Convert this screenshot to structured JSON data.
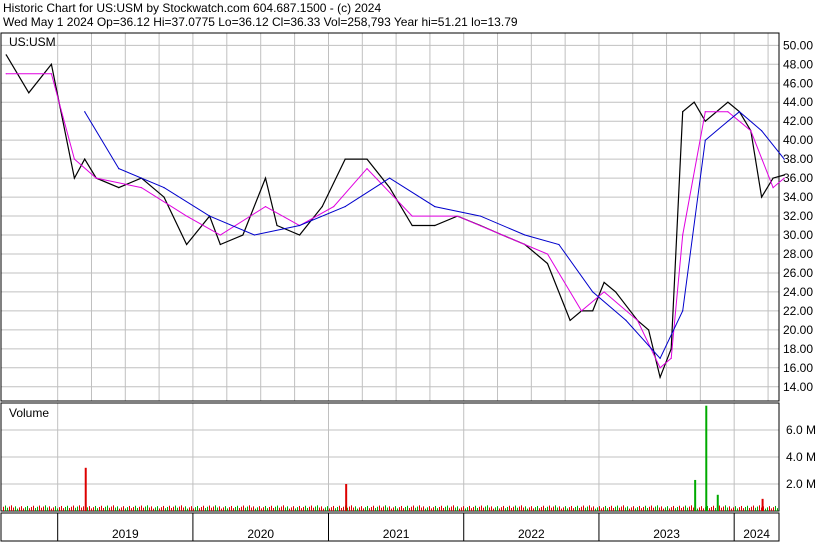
{
  "header": {
    "line1": "Historic Chart for US:USM by Stockwatch.com 604.687.1500 - (c) 2024",
    "line2": "Wed May  1 2024   Op=36.12   Hi=37.0775   Lo=36.12   Cl=36.33   Vol=258,793   Year hi=51.21   lo=13.79"
  },
  "colors": {
    "price": "#000000",
    "ma_short": "#e000e0",
    "ma_long": "#0000cc",
    "vol_up": "#00aa00",
    "vol_down": "#dd0000",
    "grid": "#c0c0c0"
  },
  "chart_data": [
    {
      "type": "line",
      "symbol_label": "US:USM",
      "ylim": [
        12.5,
        51.3
      ],
      "y_ticks": [
        "14.00",
        "16.00",
        "18.00",
        "20.00",
        "22.00",
        "24.00",
        "26.00",
        "28.00",
        "30.00",
        "32.00",
        "34.00",
        "36.00",
        "38.00",
        "40.00",
        "42.00",
        "44.00",
        "46.00",
        "48.00",
        "50.00"
      ],
      "x_ticks": [
        "2019",
        "2020",
        "2021",
        "2022",
        "2023",
        "2024"
      ],
      "x_range": [
        "2018-08-01",
        "2024-05-01"
      ],
      "grid": true,
      "series": [
        {
          "role": "price",
          "x": [
            "2018-08",
            "2018-10",
            "2018-12",
            "2019-02",
            "2019-03",
            "2019-04",
            "2019-06",
            "2019-08",
            "2019-10",
            "2019-12",
            "2020-02",
            "2020-03",
            "2020-05",
            "2020-07",
            "2020-08",
            "2020-10",
            "2020-12",
            "2021-02",
            "2021-04",
            "2021-06",
            "2021-08",
            "2021-10",
            "2021-12",
            "2022-02",
            "2022-04",
            "2022-06",
            "2022-08",
            "2022-10",
            "2022-11",
            "2022-12",
            "2023-01",
            "2023-02",
            "2023-04",
            "2023-05",
            "2023-06",
            "2023-07",
            "2023-08",
            "2023-09",
            "2023-10",
            "2023-12",
            "2024-01",
            "2024-02",
            "2024-03",
            "2024-04",
            "2024-05"
          ],
          "values": [
            49,
            45,
            48,
            36,
            38,
            36,
            35,
            36,
            34,
            29,
            32,
            29,
            30,
            36,
            31,
            30,
            33,
            38,
            38,
            35,
            31,
            31,
            32,
            31,
            30,
            29,
            27,
            21,
            22,
            22,
            25,
            24,
            21,
            20,
            15,
            18,
            43,
            44,
            42,
            44,
            43,
            41,
            34,
            36,
            36.33
          ]
        },
        {
          "role": "moving-average-short",
          "x": [
            "2018-08",
            "2018-12",
            "2019-02",
            "2019-04",
            "2019-08",
            "2019-12",
            "2020-03",
            "2020-07",
            "2020-10",
            "2021-01",
            "2021-04",
            "2021-08",
            "2021-12",
            "2022-04",
            "2022-08",
            "2022-11",
            "2023-01",
            "2023-04",
            "2023-06",
            "2023-07",
            "2023-08",
            "2023-10",
            "2023-12",
            "2024-02",
            "2024-04",
            "2024-05"
          ],
          "values": [
            47,
            47,
            38,
            36,
            35,
            32,
            30,
            33,
            31,
            33,
            37,
            32,
            32,
            30,
            28,
            22,
            24,
            21,
            16,
            17,
            30,
            43,
            43,
            41,
            35,
            36
          ]
        },
        {
          "role": "moving-average-long",
          "x": [
            "2019-03",
            "2019-06",
            "2019-10",
            "2020-02",
            "2020-06",
            "2020-10",
            "2021-02",
            "2021-06",
            "2021-10",
            "2022-02",
            "2022-06",
            "2022-09",
            "2022-12",
            "2023-03",
            "2023-06",
            "2023-08",
            "2023-10",
            "2023-12",
            "2024-01",
            "2024-03",
            "2024-05"
          ],
          "values": [
            43,
            37,
            35,
            32,
            30,
            31,
            33,
            36,
            33,
            32,
            30,
            29,
            24,
            21,
            17,
            22,
            40,
            42,
            43,
            41,
            38
          ]
        }
      ]
    },
    {
      "type": "bar",
      "title": "Volume",
      "ylim": [
        0,
        8.0
      ],
      "y_ticks": [
        "2.0 M",
        "4.0 M",
        "6.0 M"
      ],
      "unit": "M",
      "spikes": [
        {
          "x": "2019-03",
          "value": 3.2,
          "dir": "down"
        },
        {
          "x": "2021-02",
          "value": 2.0,
          "dir": "down"
        },
        {
          "x": "2023-09",
          "value": 2.3,
          "dir": "up"
        },
        {
          "x": "2023-10",
          "value": 7.8,
          "dir": "up"
        },
        {
          "x": "2023-11",
          "value": 1.2,
          "dir": "up"
        },
        {
          "x": "2024-03",
          "value": 0.9,
          "dir": "down"
        }
      ],
      "baseline_value": 0.3
    }
  ]
}
